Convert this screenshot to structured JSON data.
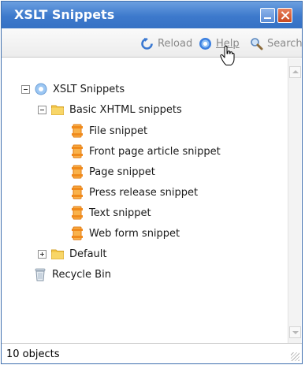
{
  "window": {
    "title": "XSLT Snippets"
  },
  "toolbar": {
    "reload_label": "Reload",
    "help_label": "Help",
    "search_label": "Search"
  },
  "tree": {
    "root": {
      "label": "XSLT Snippets",
      "icon": "globe-icon"
    },
    "basic": {
      "label": "Basic XHTML snippets",
      "icon": "folder-icon"
    },
    "items": [
      {
        "label": "File snippet",
        "icon": "document-icon"
      },
      {
        "label": "Front page article snippet",
        "icon": "document-icon"
      },
      {
        "label": "Page snippet",
        "icon": "document-icon"
      },
      {
        "label": "Press release snippet",
        "icon": "document-icon"
      },
      {
        "label": "Text snippet",
        "icon": "document-icon"
      },
      {
        "label": "Web form snippet",
        "icon": "document-icon"
      }
    ],
    "default": {
      "label": "Default",
      "icon": "folder-icon"
    },
    "recycle": {
      "label": "Recycle Bin",
      "icon": "recycle-bin-icon"
    }
  },
  "status": {
    "text": "10 objects"
  },
  "colors": {
    "titlebar": "#3d79cc",
    "accent": "#2f6fd0",
    "folder": "#f4c84a",
    "document": "#f08a1c"
  }
}
